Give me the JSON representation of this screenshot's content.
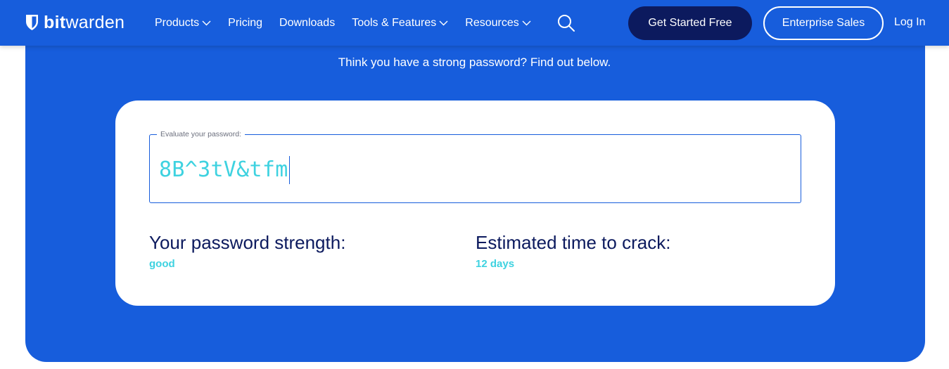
{
  "nav": {
    "brand_bold": "bit",
    "brand_light": "warden",
    "menu": [
      {
        "label": "Products",
        "dropdown": true
      },
      {
        "label": "Pricing",
        "dropdown": false
      },
      {
        "label": "Downloads",
        "dropdown": false
      },
      {
        "label": "Tools & Features",
        "dropdown": true
      },
      {
        "label": "Resources",
        "dropdown": true
      }
    ],
    "search_icon": "search-icon",
    "cta_primary": "Get Started Free",
    "cta_secondary": "Enterprise Sales",
    "login": "Log In"
  },
  "hero": {
    "tagline": "Think you have a strong password? Find out below."
  },
  "checker": {
    "field_label": "Evaluate your password:",
    "password_value": "8B^3tV&tfm",
    "strength_heading": "Your password strength:",
    "strength_value": "good",
    "crack_heading": "Estimated time to crack:",
    "crack_value": "12 days"
  },
  "colors": {
    "brand_blue": "#175DDC",
    "navy": "#0C1A5E",
    "accent_cyan": "#3ED2E0"
  }
}
